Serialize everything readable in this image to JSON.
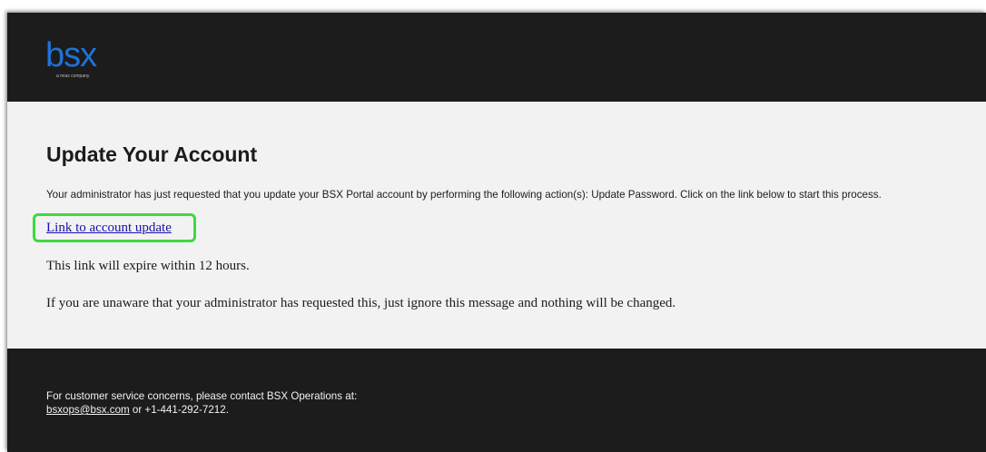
{
  "header": {
    "logo_text": "bsx",
    "logo_tagline": "a miax company"
  },
  "main": {
    "title": "Update Your Account",
    "intro": "Your administrator has just requested that you update your BSX Portal account by performing the following action(s): Update Password. Click on the link below to start this process.",
    "link_label": "Link to account update",
    "expire_text": "This link will expire within 12 hours.",
    "ignore_text": "If you are unaware that your administrator has requested this, just ignore this message and nothing will be changed."
  },
  "footer": {
    "contact_text": "For customer service concerns, please contact BSX Operations at:",
    "email": "bsxops@bsx.com",
    "phone_text": " or +1-441-292-7212."
  },
  "colors": {
    "header_bg": "#1c1c1c",
    "content_bg": "#f2f2f2",
    "logo_blue": "#1e73d8",
    "highlight_green": "#3fd83f",
    "link_blue": "#1a0dab"
  }
}
